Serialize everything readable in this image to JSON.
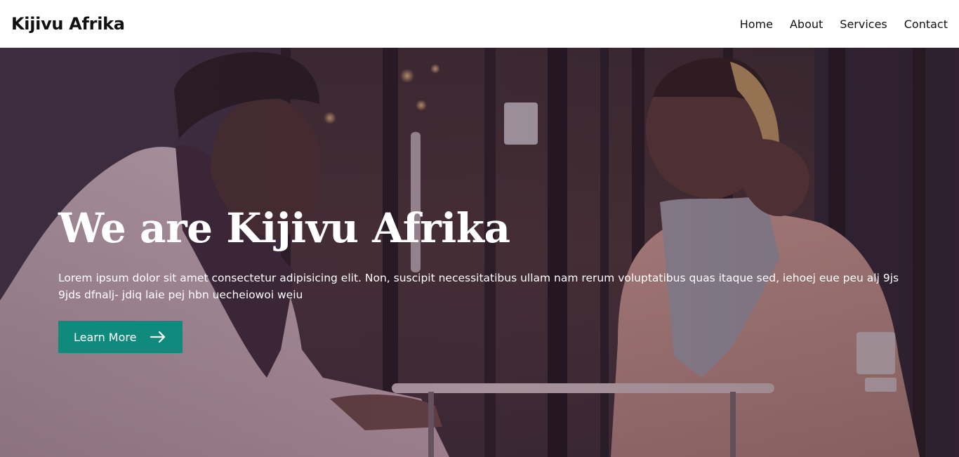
{
  "brand": {
    "name": "Kijivu Afrika"
  },
  "nav": {
    "items": [
      {
        "label": "Home"
      },
      {
        "label": "About"
      },
      {
        "label": "Services"
      },
      {
        "label": "Contact"
      }
    ]
  },
  "hero": {
    "title": "We are Kijivu Afrika",
    "text": "Lorem ipsum dolor sit amet consectetur adipisicing elit. Non, suscipit necessitatibus ullam nam rerum voluptatibus quas itaque sed, iehoej eue peu alj 9js 9jds dfnalj- jdiq laie pej hbn uecheiowoi weiu",
    "cta_label": "Learn More",
    "cta_icon": "arrow-right-icon",
    "background_image": "two-people-at-cafe-table-photo"
  },
  "colors": {
    "accent": "#0f8a7d",
    "nav_bg": "#ffffff",
    "text_dark": "#111111",
    "hero_text": "#ffffff"
  }
}
